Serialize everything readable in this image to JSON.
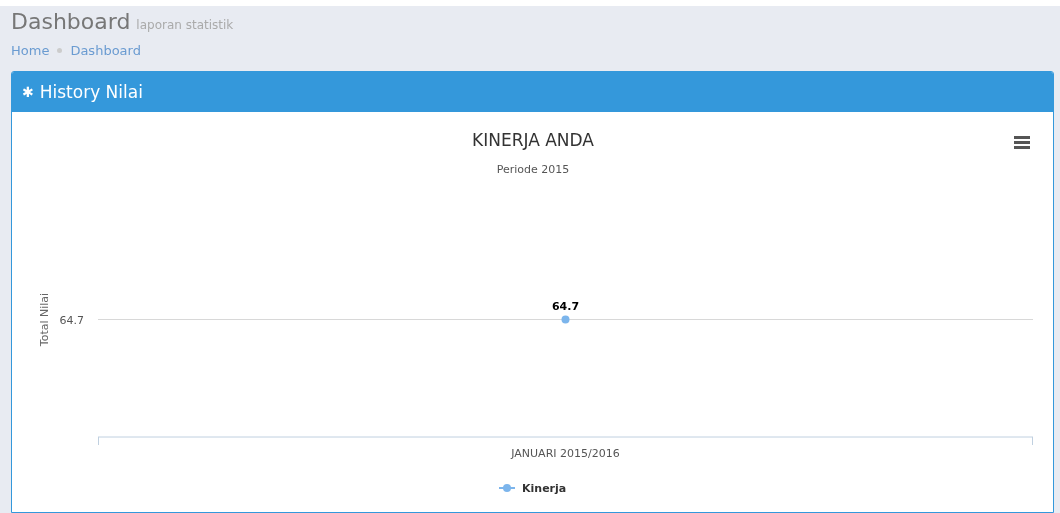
{
  "header": {
    "title": "Dashboard",
    "subtitle": "laporan statistik"
  },
  "breadcrumb": [
    {
      "label": "Home"
    },
    {
      "label": "Dashboard"
    }
  ],
  "panel": {
    "icon": "✱",
    "title": "History Nilai",
    "chart": {
      "title": "KINERJA ANDA",
      "subtitle": "Periode 2015",
      "y_axis_title": "Total Nilai",
      "y_axis_labels": [
        "64.7"
      ],
      "x_axis_labels": [
        "JANUARI 2015/2016"
      ],
      "series": [
        {
          "name": "Kinerja",
          "color": "#7cb5ec",
          "point_labels": [
            "64.7"
          ]
        }
      ]
    }
  }
}
